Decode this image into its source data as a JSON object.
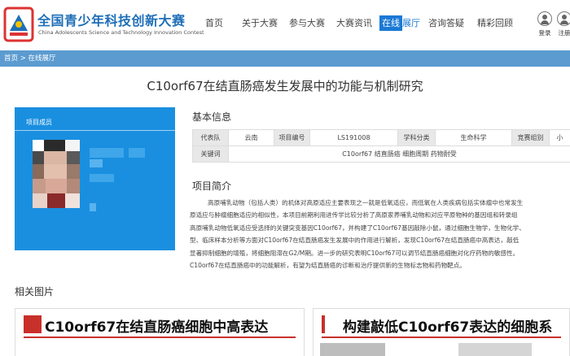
{
  "header": {
    "brand_cn": "全国青少年科技创新大赛",
    "brand_en": "China Adolescents Science and Technology Innovation Contest",
    "nav": [
      {
        "label": "首页"
      },
      {
        "label": "关于大赛"
      },
      {
        "label": "参与大赛"
      },
      {
        "label": "大赛资讯"
      },
      {
        "label_hl": "在线",
        "label_rest": "展厅"
      },
      {
        "label": "咨询答疑"
      },
      {
        "label": "精彩回顾"
      }
    ],
    "login": "登录",
    "register": "注册"
  },
  "breadcrumb": "首页 > 在线展厅",
  "project": {
    "title": "C10orf67在结直肠癌发生发展中的功能与机制研究",
    "members_label": "项目成员",
    "basic_heading": "基本信息",
    "fields": {
      "delegation_k": "代表队",
      "delegation_v": "云南",
      "number_k": "项目编号",
      "number_v": "LS191008",
      "subject_k": "学科分类",
      "subject_v": "生命科学",
      "group_k": "竞赛组别",
      "group_v": "小",
      "keywords_k": "关键词",
      "keywords_v": "C10orf67 结直肠癌 细胞周期 药物耐受"
    },
    "intro_heading": "项目简介",
    "intro_lines": [
      "高原哺乳动物（包括人类）的机体对高原适应主要表现之一就是低氧适应，而低氧在人类疾病包括实体瘤中也常发生",
      "原适应与肿瘤细胞适应的相似性，本项目前期利用进传学比较分析了高原家养哺乳动物和对应平原物种的基因组和转录组",
      "高原哺乳动物低氧适应受选择的关键突变基因C10orf67，并构建了C10orf67基因敲除小鼠，通过细胞生物学，生物化学、",
      "型、临床样本分析等方面对C10orf67在结直肠癌发生发展中的作用进行解析，发现C10orf67在结直肠癌中高表达，敲低",
      "显著抑制细胞的增殖，将细胞阻滞在G2/M期。进一步的研究表明C10orf67可以调节结直肠癌细胞对化疗药物的敏感性。",
      "C10orf67在结直肠癌中的功能解析，有望为结直肠癌的诊断和治疗提供新的生物标志物和药物靶点。"
    ],
    "pics_heading": "相关图片",
    "pic_captions": [
      "C10orf67在结直肠癌细胞中高表达",
      "构建敲低C10orf67表达的细胞系"
    ]
  },
  "colors": {
    "brand_blue": "#1f6fb8",
    "nav_active": "#1a79d6",
    "breadcrumb_bg": "#5b9bd0",
    "member_panel": "#1a8fe0",
    "caption_red": "#c8302a"
  }
}
